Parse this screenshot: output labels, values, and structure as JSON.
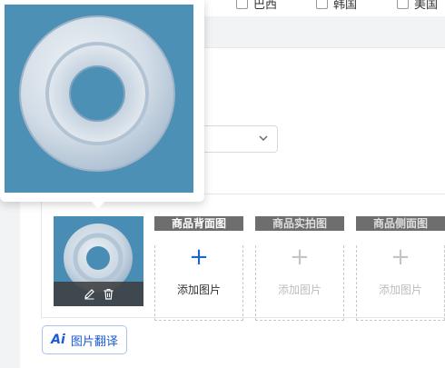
{
  "countries": [
    "巴西",
    "韩国",
    "美国"
  ],
  "image_slots": [
    {
      "label": "商品背面图",
      "action": "添加图片",
      "state": "active"
    },
    {
      "label": "商品实拍图",
      "action": "添加图片",
      "state": "disabled"
    },
    {
      "label": "商品侧面图",
      "action": "添加图片",
      "state": "disabled"
    }
  ],
  "thumbnail": {
    "icons": [
      "edit-icon",
      "delete-icon"
    ],
    "subject": "white plastic ring washer"
  },
  "translate_button": {
    "ai_mark": "Ai",
    "label": "图片翻译"
  },
  "colors": {
    "accent": "#1a66d6",
    "image_bg": "#4d90b6",
    "slot_label_bg": "#6e6e6e"
  }
}
